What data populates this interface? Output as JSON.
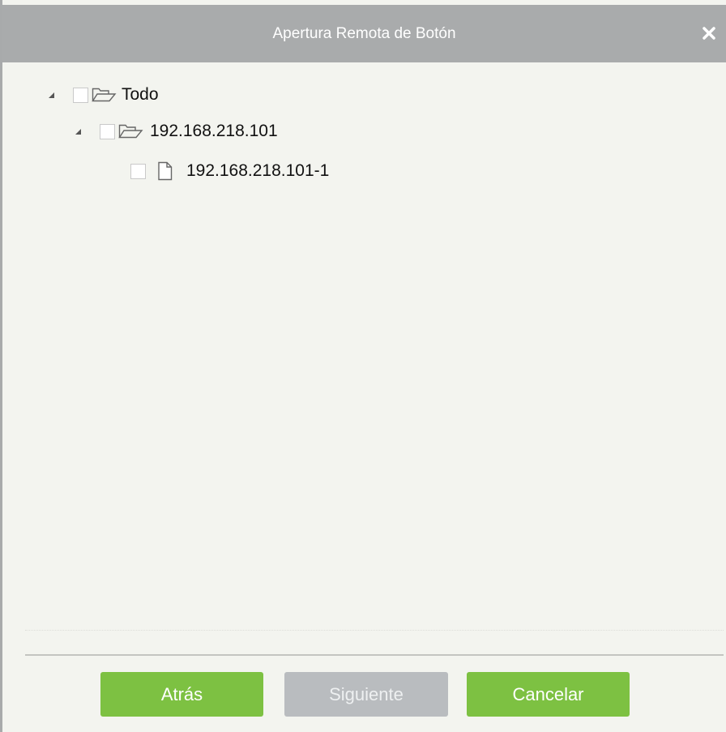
{
  "dialog": {
    "title": "Apertura Remota de Botón",
    "close_symbol": "×"
  },
  "tree": {
    "root": {
      "label": "Todo",
      "icon": "folder-open-icon",
      "expanded": true,
      "checked": false
    },
    "device": {
      "label": "192.168.218.101",
      "icon": "folder-open-icon",
      "expanded": true,
      "checked": false
    },
    "door": {
      "label": "192.168.218.101-1",
      "icon": "file-icon",
      "checked": false
    }
  },
  "buttons": {
    "back_label": "Atrás",
    "next_label": "Siguiente",
    "cancel_label": "Cancelar"
  },
  "colors": {
    "titlebar": "#a9abac",
    "body_bg": "#f3f4ef",
    "button_green": "#7dc142",
    "button_disabled": "#b9bcbf"
  }
}
